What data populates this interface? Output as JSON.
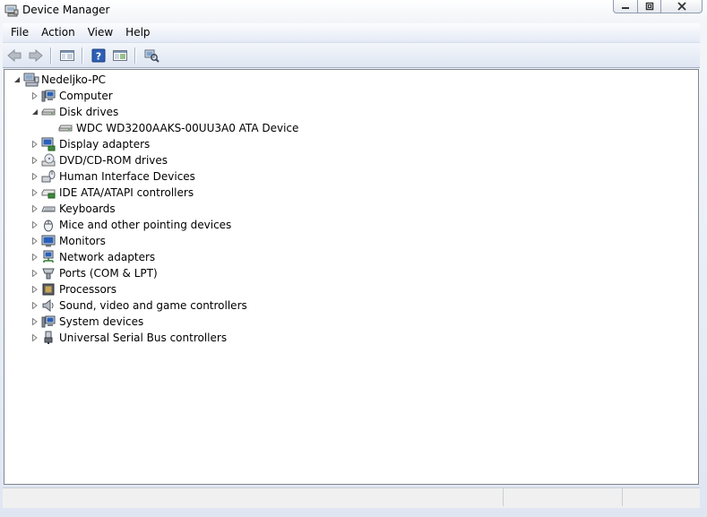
{
  "window": {
    "title": "Device Manager",
    "icon": "device-manager-icon"
  },
  "menu": {
    "items": [
      "File",
      "Action",
      "View",
      "Help"
    ]
  },
  "toolbar": {
    "buttons": [
      "back-arrow-icon",
      "forward-arrow-icon",
      "show-hide-console-tree-icon",
      "help-icon",
      "properties-icon",
      "scan-hardware-icon"
    ]
  },
  "tree": {
    "root": {
      "label": "Nedeljko-PC",
      "icon": "computer-icon",
      "expanded": true
    },
    "items": [
      {
        "label": "Computer",
        "icon": "computer-icon",
        "expanded": false
      },
      {
        "label": "Disk drives",
        "icon": "disk-drive-icon",
        "expanded": true
      },
      {
        "label": "WDC WD3200AAKS-00UU3A0 ATA Device",
        "icon": "disk-drive-icon",
        "child": true
      },
      {
        "label": "Display adapters",
        "icon": "display-adapter-icon",
        "expanded": false
      },
      {
        "label": "DVD/CD-ROM drives",
        "icon": "dvd-drive-icon",
        "expanded": false
      },
      {
        "label": "Human Interface Devices",
        "icon": "hid-icon",
        "expanded": false
      },
      {
        "label": "IDE ATA/ATAPI controllers",
        "icon": "ide-controller-icon",
        "expanded": false
      },
      {
        "label": "Keyboards",
        "icon": "keyboard-icon",
        "expanded": false
      },
      {
        "label": "Mice and other pointing devices",
        "icon": "mouse-icon",
        "expanded": false
      },
      {
        "label": "Monitors",
        "icon": "monitor-icon",
        "expanded": false
      },
      {
        "label": "Network adapters",
        "icon": "network-adapter-icon",
        "expanded": false
      },
      {
        "label": "Ports (COM & LPT)",
        "icon": "port-icon",
        "expanded": false
      },
      {
        "label": "Processors",
        "icon": "processor-icon",
        "expanded": false
      },
      {
        "label": "Sound, video and game controllers",
        "icon": "sound-icon",
        "expanded": false
      },
      {
        "label": "System devices",
        "icon": "system-devices-icon",
        "expanded": false
      },
      {
        "label": "Universal Serial Bus controllers",
        "icon": "usb-icon",
        "expanded": false
      }
    ]
  }
}
